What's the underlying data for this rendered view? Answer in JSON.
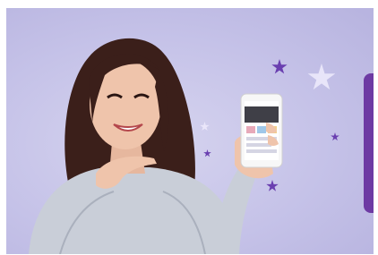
{
  "scene": {
    "background_color": "#c8c5ea",
    "accent_color": "#6d3aa3",
    "star_color": "#6a3fb0",
    "description_icons": [
      "star-icon",
      "smartphone-icon"
    ]
  }
}
